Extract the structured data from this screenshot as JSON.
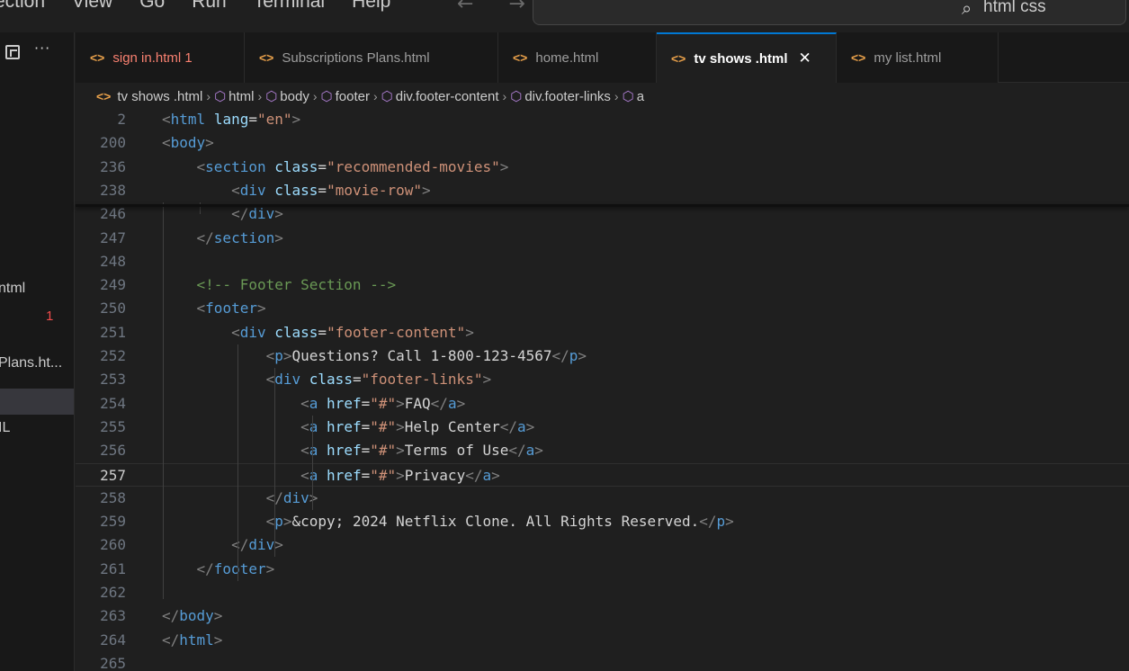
{
  "menubar": {
    "items": [
      "ection",
      "View",
      "Go",
      "Run",
      "Terminal",
      "Help"
    ],
    "nav_arrows": "← →",
    "search_text": "html css"
  },
  "sidebar": {
    "items": [
      {
        "label": "ntml",
        "badge": "1"
      },
      {
        "label": "Plans.ht..."
      },
      {
        "label": ""
      },
      {
        "label": "IL"
      }
    ]
  },
  "tabs": [
    {
      "label": "sign in.html 1",
      "state": "error"
    },
    {
      "label": "Subscriptions Plans.html"
    },
    {
      "label": "home.html"
    },
    {
      "label": "tv shows .html",
      "state": "active"
    },
    {
      "label": "my list.html"
    }
  ],
  "breadcrumb": [
    "tv shows .html",
    "html",
    "body",
    "footer",
    "div.footer-content",
    "div.footer-links",
    "a"
  ],
  "editor": {
    "current_line": "257",
    "lines": [
      {
        "n": "2",
        "html": "<span class='t-br'>&lt;</span><span class='t-tag'>html</span> <span class='t-attr'>lang</span><span class='t-txt'>=</span><span class='t-str'>\"en\"</span><span class='t-br'>&gt;</span>"
      },
      {
        "n": "200",
        "html": "<span class='t-br'>&lt;</span><span class='t-tag'>body</span><span class='t-br'>&gt;</span>"
      },
      {
        "n": "236",
        "html": "    <span class='t-br'>&lt;</span><span class='t-tag'>section</span> <span class='t-attr'>class</span><span class='t-txt'>=</span><span class='t-str'>\"recommended-movies\"</span><span class='t-br'>&gt;</span>"
      },
      {
        "n": "238",
        "html": "        <span class='t-br'>&lt;</span><span class='t-tag'>div</span> <span class='t-attr'>class</span><span class='t-txt'>=</span><span class='t-str'>\"movie-row\"</span><span class='t-br'>&gt;</span>"
      },
      {
        "n": "246",
        "html": "        <span class='t-br'>&lt;/</span><span class='t-tag'>div</span><span class='t-br'>&gt;</span>"
      },
      {
        "n": "247",
        "html": "    <span class='t-br'>&lt;/</span><span class='t-tag'>section</span><span class='t-br'>&gt;</span>"
      },
      {
        "n": "248",
        "html": ""
      },
      {
        "n": "249",
        "html": "    <span class='t-com'>&lt;!-- Footer Section --&gt;</span>"
      },
      {
        "n": "250",
        "html": "    <span class='t-br'>&lt;</span><span class='t-tag'>footer</span><span class='t-br'>&gt;</span>"
      },
      {
        "n": "251",
        "html": "        <span class='t-br'>&lt;</span><span class='t-tag'>div</span> <span class='t-attr'>class</span><span class='t-txt'>=</span><span class='t-str'>\"footer-content\"</span><span class='t-br'>&gt;</span>"
      },
      {
        "n": "252",
        "html": "            <span class='t-br'>&lt;</span><span class='t-tag'>p</span><span class='t-br'>&gt;</span><span class='t-txt'>Questions? Call 1-800-123-4567</span><span class='t-br'>&lt;/</span><span class='t-tag'>p</span><span class='t-br'>&gt;</span>"
      },
      {
        "n": "253",
        "html": "            <span class='t-br'>&lt;</span><span class='t-tag'>div</span> <span class='t-attr'>class</span><span class='t-txt'>=</span><span class='t-str'>\"footer-links\"</span><span class='t-br'>&gt;</span>"
      },
      {
        "n": "254",
        "html": "                <span class='t-br'>&lt;</span><span class='t-tag'>a</span> <span class='t-attr'>href</span><span class='t-txt'>=</span><span class='t-str'>\"#\"</span><span class='t-br'>&gt;</span><span class='t-txt'>FAQ</span><span class='t-br'>&lt;/</span><span class='t-tag'>a</span><span class='t-br'>&gt;</span>"
      },
      {
        "n": "255",
        "html": "                <span class='t-br'>&lt;</span><span class='t-tag'>a</span> <span class='t-attr'>href</span><span class='t-txt'>=</span><span class='t-str'>\"#\"</span><span class='t-br'>&gt;</span><span class='t-txt'>Help Center</span><span class='t-br'>&lt;/</span><span class='t-tag'>a</span><span class='t-br'>&gt;</span>"
      },
      {
        "n": "256",
        "html": "                <span class='t-br'>&lt;</span><span class='t-tag'>a</span> <span class='t-attr'>href</span><span class='t-txt'>=</span><span class='t-str'>\"#\"</span><span class='t-br'>&gt;</span><span class='t-txt'>Terms of Use</span><span class='t-br'>&lt;/</span><span class='t-tag'>a</span><span class='t-br'>&gt;</span>"
      },
      {
        "n": "257",
        "html": "                <span class='t-br'>&lt;</span><span class='t-tag'>a</span> <span class='t-attr'>href</span><span class='t-txt'>=</span><span class='t-str'>\"#\"</span><span class='t-br'>&gt;</span><span class='t-txt'>Privacy</span><span class='t-br'>&lt;/</span><span class='t-tag'>a</span><span class='t-br'>&gt;</span>"
      },
      {
        "n": "258",
        "html": "            <span class='t-br'>&lt;/</span><span class='t-tag'>div</span><span class='t-br'>&gt;</span>"
      },
      {
        "n": "259",
        "html": "            <span class='t-br'>&lt;</span><span class='t-tag'>p</span><span class='t-br'>&gt;</span><span class='t-txt'>&amp;copy; 2024 Netflix Clone. All Rights Reserved.</span><span class='t-br'>&lt;/</span><span class='t-tag'>p</span><span class='t-br'>&gt;</span>"
      },
      {
        "n": "260",
        "html": "        <span class='t-br'>&lt;/</span><span class='t-tag'>div</span><span class='t-br'>&gt;</span>"
      },
      {
        "n": "261",
        "html": "    <span class='t-br'>&lt;/</span><span class='t-tag'>footer</span><span class='t-br'>&gt;</span>"
      },
      {
        "n": "262",
        "html": ""
      },
      {
        "n": "263",
        "html": "<span class='t-br'>&lt;/</span><span class='t-tag'>body</span><span class='t-br'>&gt;</span>"
      },
      {
        "n": "264",
        "html": "<span class='t-br'>&lt;/</span><span class='t-tag'>html</span><span class='t-br'>&gt;</span>"
      },
      {
        "n": "265",
        "html": ""
      }
    ]
  }
}
